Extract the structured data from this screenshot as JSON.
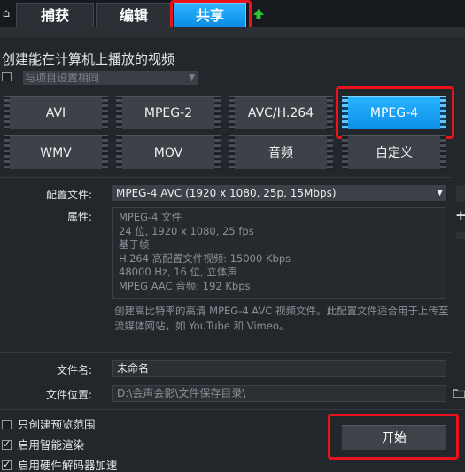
{
  "tabs": {
    "capture": "捕获",
    "edit": "编辑",
    "share": "共享"
  },
  "section_title": "创建能在计算机上播放的视频",
  "project_settings": {
    "label": "与项目设置相同",
    "checked": false
  },
  "formats": [
    {
      "label": "AVI",
      "selected": false
    },
    {
      "label": "MPEG-2",
      "selected": false
    },
    {
      "label": "AVC/H.264",
      "selected": false
    },
    {
      "label": "MPEG-4",
      "selected": true
    },
    {
      "label": "WMV",
      "selected": false
    },
    {
      "label": "MOV",
      "selected": false
    },
    {
      "label": "音频",
      "selected": false
    },
    {
      "label": "自定义",
      "selected": false
    }
  ],
  "profile": {
    "label": "配置文件:",
    "value": "MPEG-4 AVC (1920 x 1080, 25p, 15Mbps)"
  },
  "properties": {
    "label": "属性:",
    "lines": [
      "MPEG-4 文件",
      "24 位, 1920 x 1080, 25 fps",
      "基于帧",
      "H.264 高配置文件视频: 15000 Kbps",
      "48000 Hz, 16 位, 立体声",
      "MPEG AAC 音频: 192 Kbps"
    ]
  },
  "description": "创建高比特率的高清 MPEG-4 AVC 视频文件。此配置文件适合用于上传至流媒体网站，如 YouTube 和 Vimeo。",
  "file_name": {
    "label": "文件名:",
    "value": "未命名"
  },
  "file_location": {
    "label": "文件位置:",
    "value": "D:\\会声会影\\文件保存目录\\"
  },
  "options": [
    {
      "label": "只创建预览范围",
      "checked": false
    },
    {
      "label": "启用智能渲染",
      "checked": true
    },
    {
      "label": "启用硬件解码器加速",
      "checked": true
    }
  ],
  "start_button": "开始",
  "colors": {
    "accent": "#1aa3f5",
    "highlight": "#e8141d",
    "background": "#22272c"
  }
}
